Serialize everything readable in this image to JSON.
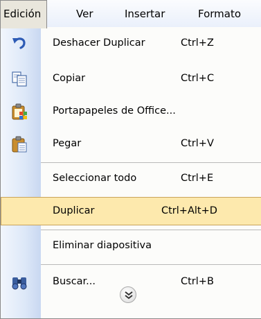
{
  "menubar": {
    "items": [
      {
        "label": "Edición",
        "state": "open"
      },
      {
        "label": "Ver"
      },
      {
        "label": "Insertar"
      },
      {
        "label": "Formato"
      }
    ]
  },
  "menu": {
    "items": [
      {
        "label": "Deshacer Duplicar",
        "shortcut": "Ctrl+Z",
        "icon": "undo-icon"
      },
      {
        "label": "Copiar",
        "shortcut": "Ctrl+C",
        "icon": "copy-icon"
      },
      {
        "label": "Portapapeles de Office...",
        "shortcut": "",
        "icon": "office-clipboard-icon"
      },
      {
        "label": "Pegar",
        "shortcut": "Ctrl+V",
        "icon": "paste-icon"
      },
      {
        "label": "Seleccionar todo",
        "shortcut": "Ctrl+E"
      },
      {
        "label": "Duplicar",
        "shortcut": "Ctrl+Alt+D",
        "state": "highlighted"
      },
      {
        "label": "Eliminar diapositiva",
        "shortcut": ""
      },
      {
        "label": "Buscar...",
        "shortcut": "Ctrl+B",
        "icon": "binoculars-icon"
      }
    ],
    "expand_icon": "chevron-double-down-icon"
  },
  "colors": {
    "highlight_fill": "#fde9ad",
    "highlight_border": "#c9a35a",
    "gutter_light": "#f2f6fd",
    "gutter_dark": "#c9d8f1",
    "menu_background": "#fcfcfa"
  }
}
